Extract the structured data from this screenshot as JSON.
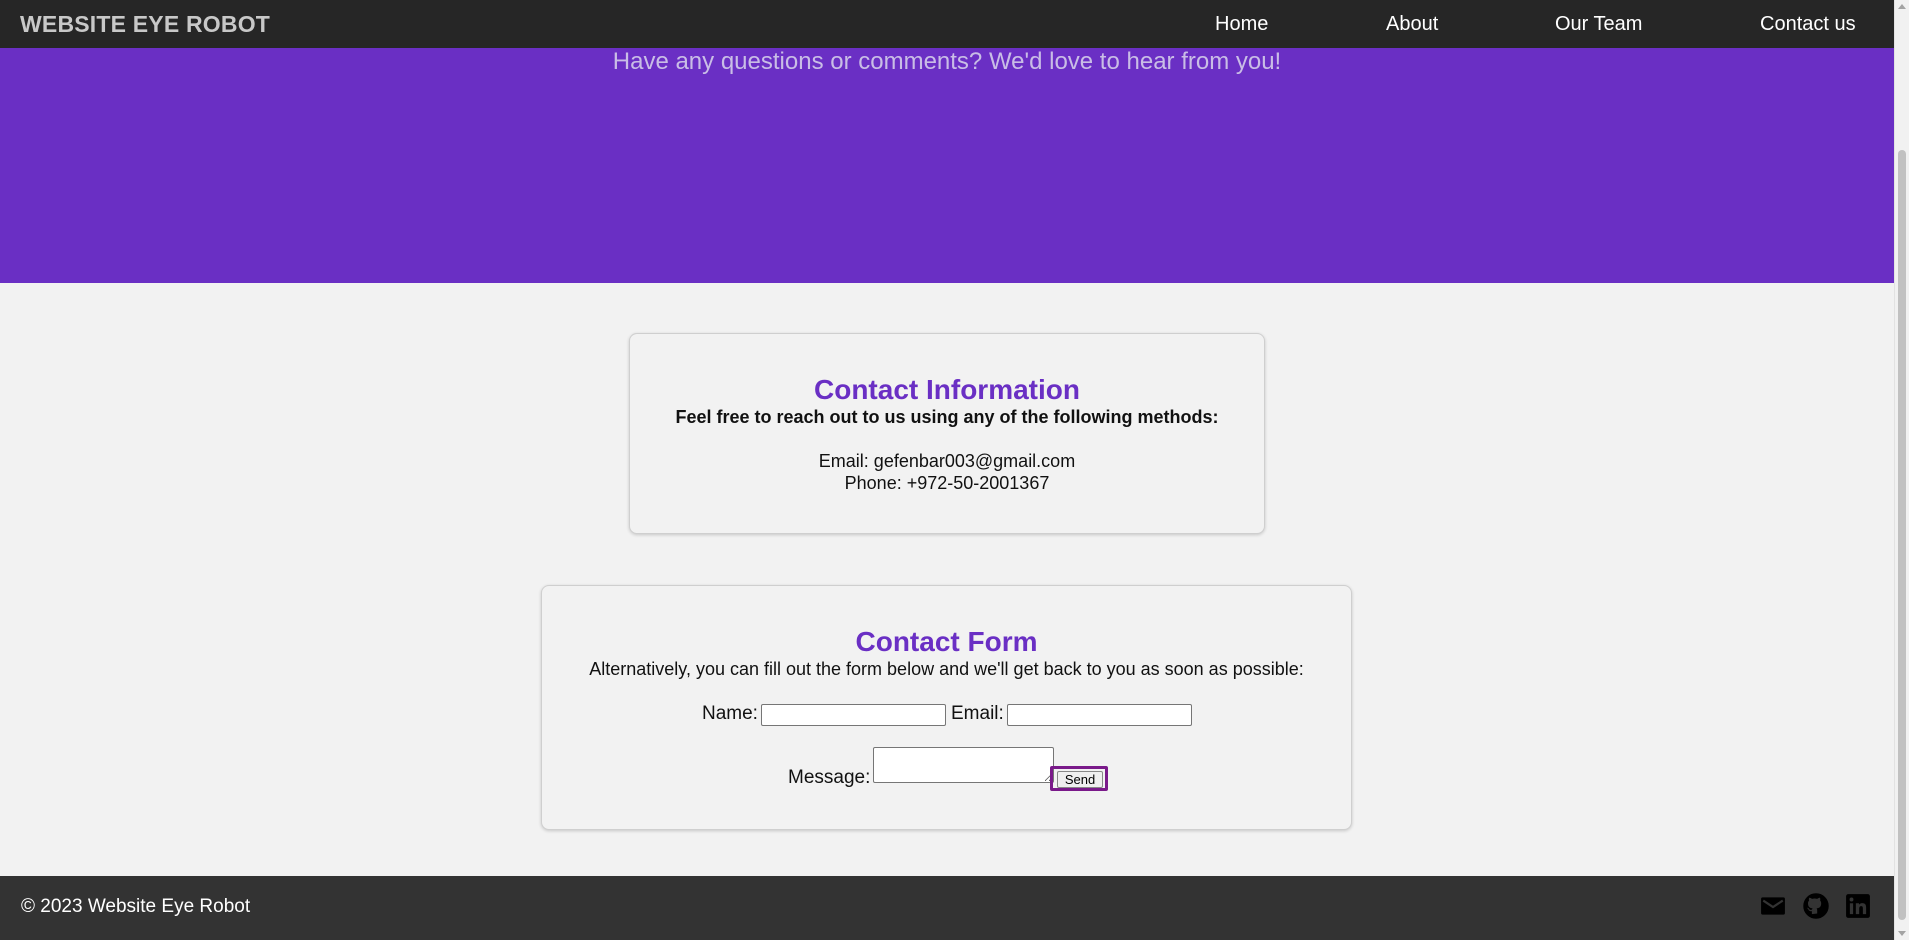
{
  "nav": {
    "brand": "WEBSITE EYE ROBOT",
    "links": [
      "Home",
      "About",
      "Our Team",
      "Contact us"
    ]
  },
  "hero": {
    "tagline": "Have any questions or comments? We'd love to hear from you!"
  },
  "contact_info": {
    "title": "Contact Information",
    "subtitle": "Feel free to reach out to us using any of the following methods:",
    "email_line": "Email: gefenbar003@gmail.com",
    "phone_line": "Phone: +972-50-2001367"
  },
  "contact_form": {
    "title": "Contact Form",
    "subtitle": "Alternatively, you can fill out the form below and we'll get back to you as soon as possible:",
    "name_label": "Name:",
    "email_label": "Email:",
    "message_label": "Message:",
    "name_value": "",
    "email_value": "",
    "message_value": "",
    "send_label": "Send"
  },
  "footer": {
    "copyright": "© 2023 Website Eye Robot",
    "icons": [
      "mail-icon",
      "github-icon",
      "linkedin-icon"
    ]
  },
  "colors": {
    "accent": "#6a2fc4",
    "nav_bg": "#262626",
    "footer_bg": "#333333",
    "page_bg": "#f2f2f2",
    "focus_outline": "#7a1a8a"
  }
}
